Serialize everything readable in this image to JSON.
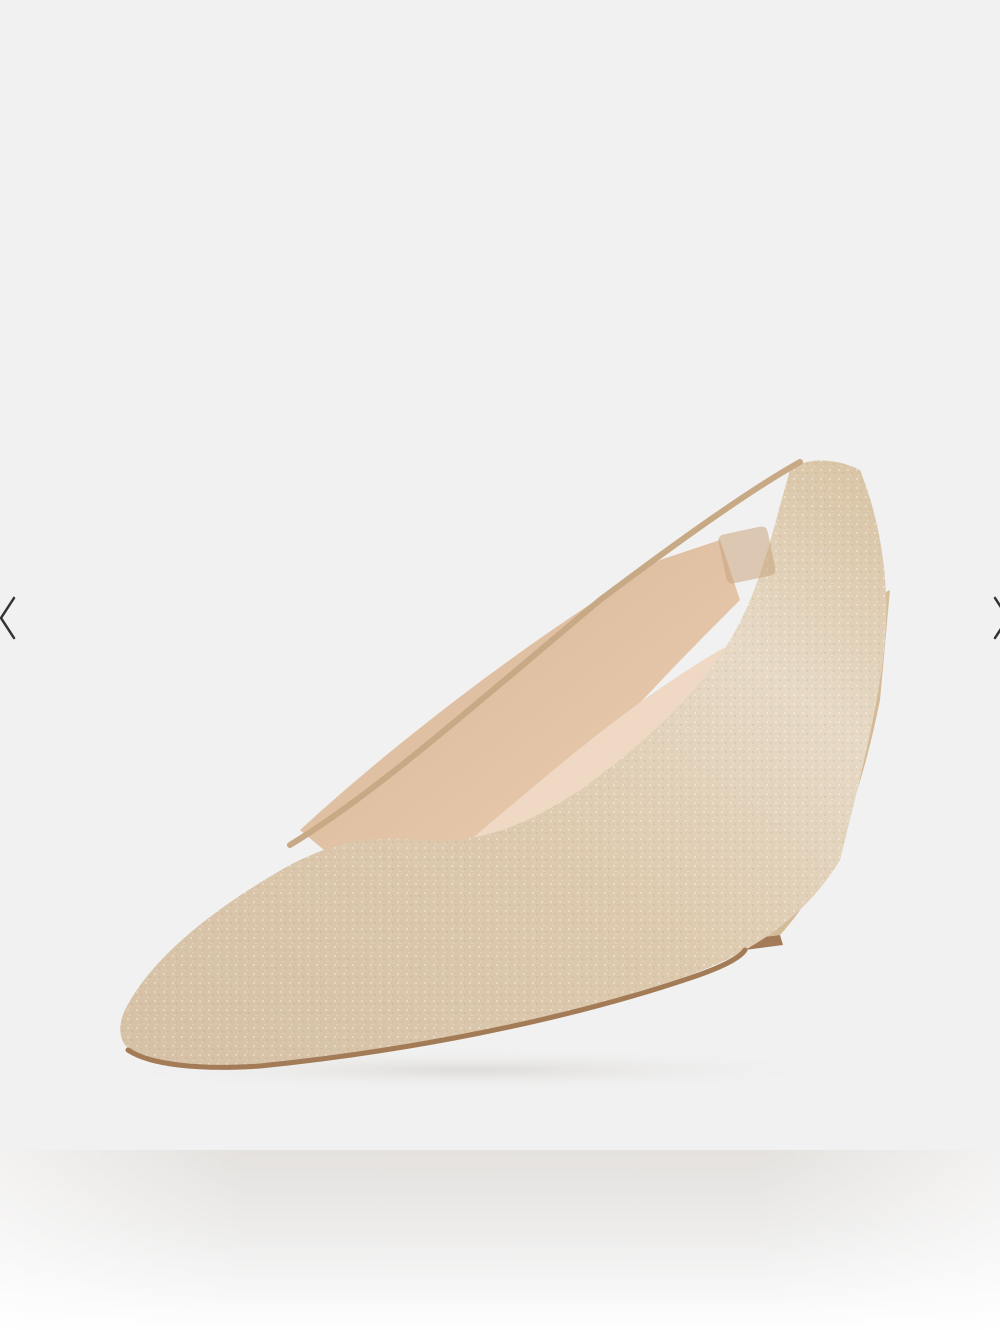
{
  "viewer": {
    "image": {
      "subject": "shoe-icon",
      "colors": {
        "background": "#f1f1f1",
        "shoe_upper": "#d9c3a4",
        "shoe_lining": "#e2c5a8",
        "insole": "#efd9c4",
        "sole_edge": "#a37c57"
      }
    },
    "navigation": {
      "prev_icon": "chevron-left-icon",
      "next_icon": "chevron-right-icon",
      "arrow_color": "#333333"
    }
  }
}
